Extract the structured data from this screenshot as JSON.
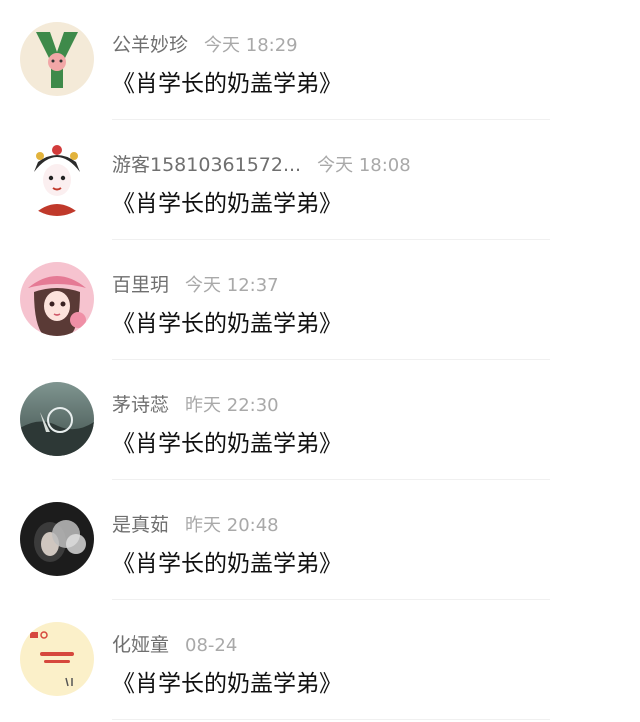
{
  "comments": [
    {
      "name": "公羊妙珍",
      "time": "今天 18:29",
      "text": "《肖学长的奶盖学弟》",
      "avatar": "letter-y-avatar-icon"
    },
    {
      "name": "游客15810361572...",
      "time": "今天 18:08",
      "text": "《肖学长的奶盖学弟》",
      "avatar": "opera-girl-avatar-icon"
    },
    {
      "name": "百里玥",
      "time": "今天 12:37",
      "text": "《肖学长的奶盖学弟》",
      "avatar": "cartoon-girl-avatar-icon"
    },
    {
      "name": "茅诗蕊",
      "time": "昨天 22:30",
      "text": "《肖学长的奶盖学弟》",
      "avatar": "landscape-avatar-icon"
    },
    {
      "name": "是真茹",
      "time": "昨天 20:48",
      "text": "《肖学长的奶盖学弟》",
      "avatar": "portrait-photo-avatar-icon"
    },
    {
      "name": "化娅童",
      "time": "08-24",
      "text": "《肖学长的奶盖学弟》",
      "avatar": "sticker-avatar-icon"
    }
  ],
  "colors": {
    "name": "#6f6f6f",
    "time": "#a9a9a9",
    "text": "#111111",
    "divider": "#f0f0f0"
  }
}
